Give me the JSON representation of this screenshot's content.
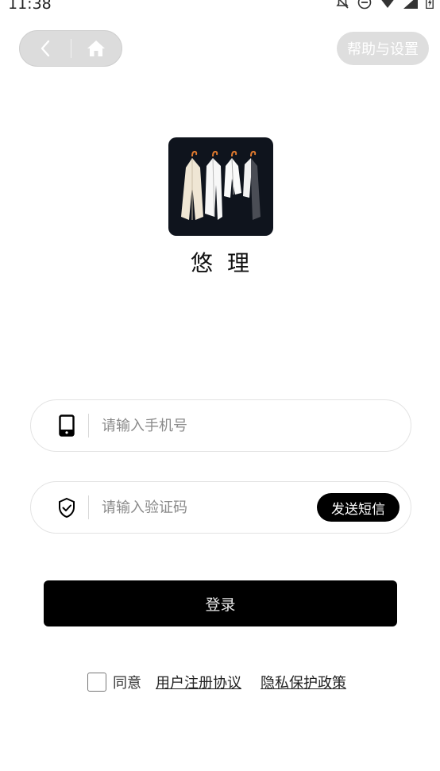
{
  "status_bar": {
    "time": "11:38",
    "icons": [
      "notifications-off-icon",
      "do-not-disturb-icon",
      "wifi-icon",
      "signal-icon",
      "battery-charging-icon"
    ]
  },
  "nav": {
    "back_icon": "back-arrow-icon",
    "home_icon": "home-icon",
    "help_label": "帮助与设置"
  },
  "app": {
    "name": "悠理",
    "logo_icon": "hanging-clothes-logo"
  },
  "form": {
    "phone_placeholder": "请输入手机号",
    "phone_value": "",
    "phone_icon": "phone-icon",
    "code_placeholder": "请输入验证码",
    "code_value": "",
    "code_icon": "shield-check-icon",
    "send_sms_label": "发送短信",
    "login_label": "登录"
  },
  "agreement": {
    "checked": false,
    "agree_label": "同意",
    "user_agreement_label": "用户注册协议",
    "privacy_policy_label": "隐私保护政策"
  },
  "colors": {
    "primary": "#000000",
    "capsule_bg": "#dcdcdc",
    "logo_bg": "#0f141d",
    "field_border": "#e3e3e3"
  }
}
